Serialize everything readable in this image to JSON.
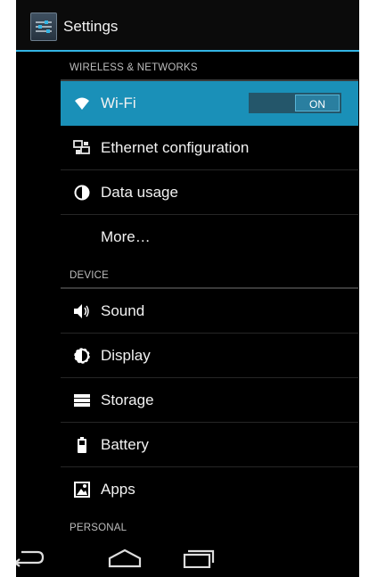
{
  "app": {
    "title": "Settings",
    "icon": "settings-icon"
  },
  "sections": {
    "wireless": "WIRELESS & NETWORKS",
    "device": "DEVICE",
    "personal": "PERSONAL"
  },
  "items": {
    "wifi": {
      "label": "Wi-Fi",
      "icon": "wifi-icon",
      "toggle": "ON"
    },
    "ethernet": {
      "label": "Ethernet configuration",
      "icon": "ethernet-icon"
    },
    "data_usage": {
      "label": "Data usage",
      "icon": "data-usage-icon"
    },
    "more": {
      "label": "More…"
    },
    "sound": {
      "label": "Sound",
      "icon": "sound-icon"
    },
    "display": {
      "label": "Display",
      "icon": "display-icon"
    },
    "storage": {
      "label": "Storage",
      "icon": "storage-icon"
    },
    "battery": {
      "label": "Battery",
      "icon": "battery-icon"
    },
    "apps": {
      "label": "Apps",
      "icon": "apps-icon"
    }
  },
  "navbar": [
    "back-icon",
    "home-icon",
    "recents-icon"
  ],
  "colors": {
    "accent": "#33b5e5",
    "selected_row": "#1a90b8",
    "background": "#000000"
  }
}
